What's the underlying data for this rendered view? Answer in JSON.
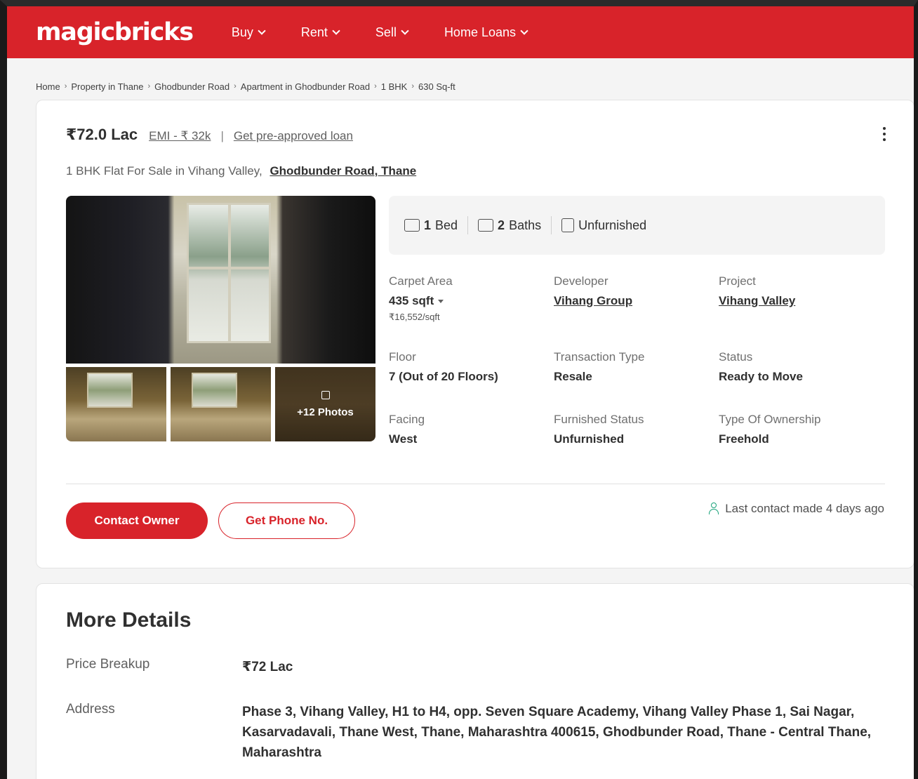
{
  "header": {
    "logo": "magicbricks",
    "nav": [
      {
        "label": "Buy"
      },
      {
        "label": "Rent"
      },
      {
        "label": "Sell"
      },
      {
        "label": "Home Loans"
      }
    ]
  },
  "breadcrumb": [
    "Home",
    "Property in Thane",
    "Ghodbunder Road",
    "Apartment in Ghodbunder Road",
    "1 BHK",
    "630 Sq-ft"
  ],
  "listing": {
    "price": "₹72.0 Lac",
    "emi": "EMI - ₹ 32k",
    "loan_link": "Get pre-approved loan",
    "subtitle": "1 BHK Flat For Sale in Vihang Valley,",
    "location_link": "Ghodbunder Road, Thane",
    "photos_more": "+12 Photos",
    "amenities": {
      "bed_count": "1",
      "bed_label": "Bed",
      "bath_count": "2",
      "bath_label": "Baths",
      "furnishing": "Unfurnished"
    },
    "facts": {
      "carpet_area_label": "Carpet Area",
      "carpet_area_value": "435 sqft",
      "price_per_sqft": "₹16,552/sqft",
      "developer_label": "Developer",
      "developer_value": "Vihang Group",
      "project_label": "Project",
      "project_value": "Vihang Valley",
      "floor_label": "Floor",
      "floor_value": "7 (Out of 20 Floors)",
      "transaction_label": "Transaction Type",
      "transaction_value": "Resale",
      "status_label": "Status",
      "status_value": "Ready to Move",
      "facing_label": "Facing",
      "facing_value": "West",
      "furnished_label": "Furnished Status",
      "furnished_value": "Unfurnished",
      "ownership_label": "Type Of Ownership",
      "ownership_value": "Freehold"
    },
    "contact_button": "Contact Owner",
    "phone_button": "Get Phone No.",
    "last_contact": "Last contact made 4 days ago"
  },
  "more_details": {
    "title": "More Details",
    "price_breakup_label": "Price Breakup",
    "price_breakup_value": "₹72 Lac",
    "address_label": "Address",
    "address_value": "Phase 3, Vihang Valley, H1 to H4, opp. Seven Square Academy, Vihang Valley Phase 1, Sai Nagar, Kasarvadavali, Thane West, Thane, Maharashtra 400615, Ghodbunder Road, Thane - Central Thane, Maharashtra"
  },
  "colors": {
    "brand_red": "#d8232a",
    "accent_green": "#1aa37a"
  }
}
